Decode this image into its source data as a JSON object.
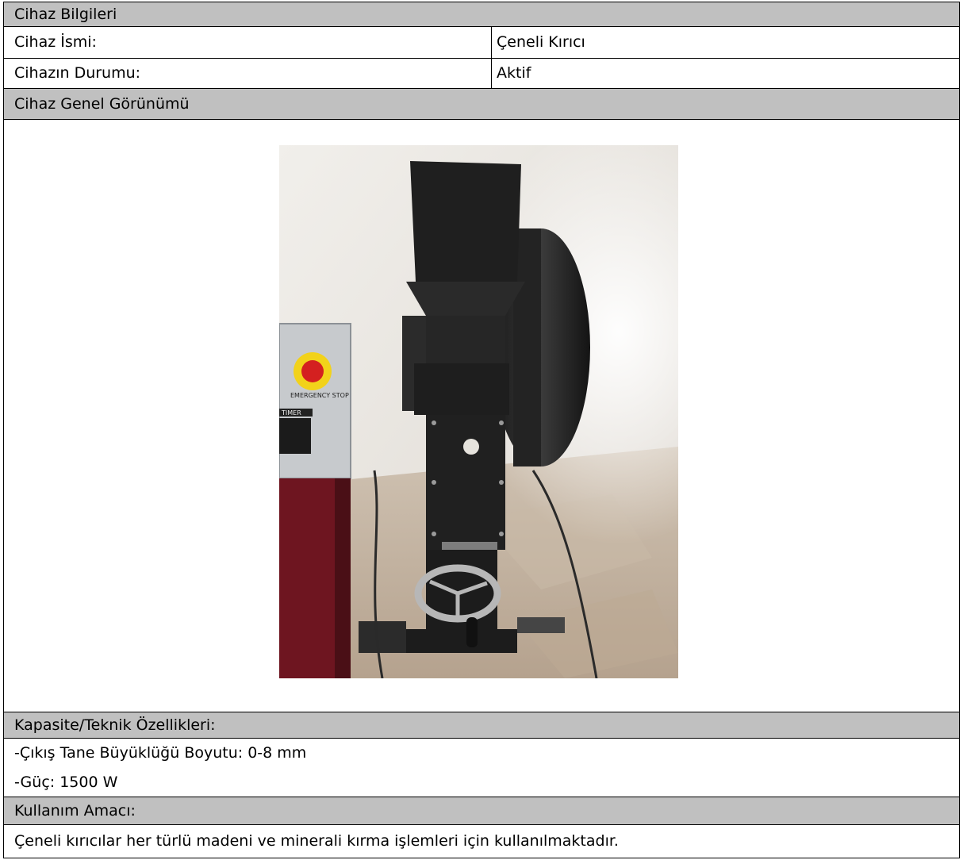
{
  "header": {
    "title": "Cihaz Bilgileri"
  },
  "info": {
    "name_label": "Cihaz İsmi:",
    "name_value": "Çeneli Kırıcı",
    "status_label": "Cihazın Durumu:",
    "status_value": "Aktif"
  },
  "view": {
    "heading": "Cihaz Genel Görünümü",
    "machine_panel_text": "EMERGENCY STOP",
    "timer_text": "TIMER"
  },
  "specs": {
    "heading": "Kapasite/Teknik Özellikleri:",
    "lines": [
      "-Çıkış Tane Büyüklüğü Boyutu: 0-8 mm",
      "-Güç: 1500 W"
    ]
  },
  "usage": {
    "heading": "Kullanım Amacı:",
    "text": "Çeneli kırıcılar her türlü madeni ve minerali kırma işlemleri için kullanılmaktadır."
  },
  "colors": {
    "header_bg": "#c0c0c0",
    "border": "#000000"
  }
}
